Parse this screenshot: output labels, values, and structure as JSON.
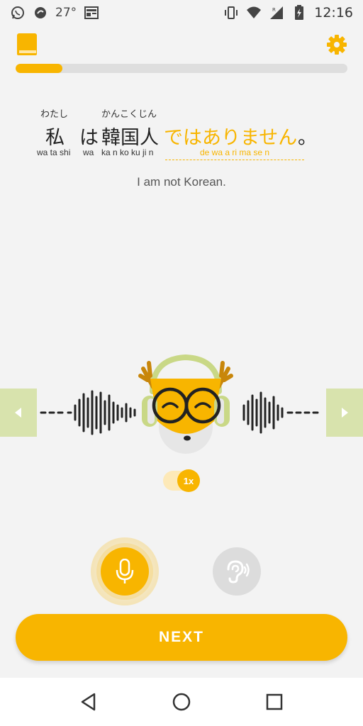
{
  "status_bar": {
    "temperature": "27°",
    "time": "12:16",
    "icons": [
      "whatsapp-icon",
      "sync-icon",
      "news-icon",
      "vibrate-icon",
      "wifi-icon",
      "signal-icon",
      "battery-icon"
    ]
  },
  "lesson": {
    "progress": 0.14,
    "furigana": {
      "watashi": "わたし",
      "kankokujin": "かんこくじん"
    },
    "japanese": {
      "watashi": "私",
      "wa": "は",
      "kankokujin": "韓国人",
      "highlight": "ではありません",
      "period": "。"
    },
    "romaji": {
      "watashi": "wa ta shi",
      "wa": "wa",
      "kankokujin": "ka n ko ku ji n",
      "highlight": "de wa a ri ma se n"
    },
    "translation": "I am not Korean."
  },
  "audio": {
    "speed_label": "1x"
  },
  "actions": {
    "next_label": "NEXT"
  },
  "colors": {
    "accent": "#f8b500",
    "side_button": "#d8e3ad",
    "background": "#f3f3f3"
  }
}
